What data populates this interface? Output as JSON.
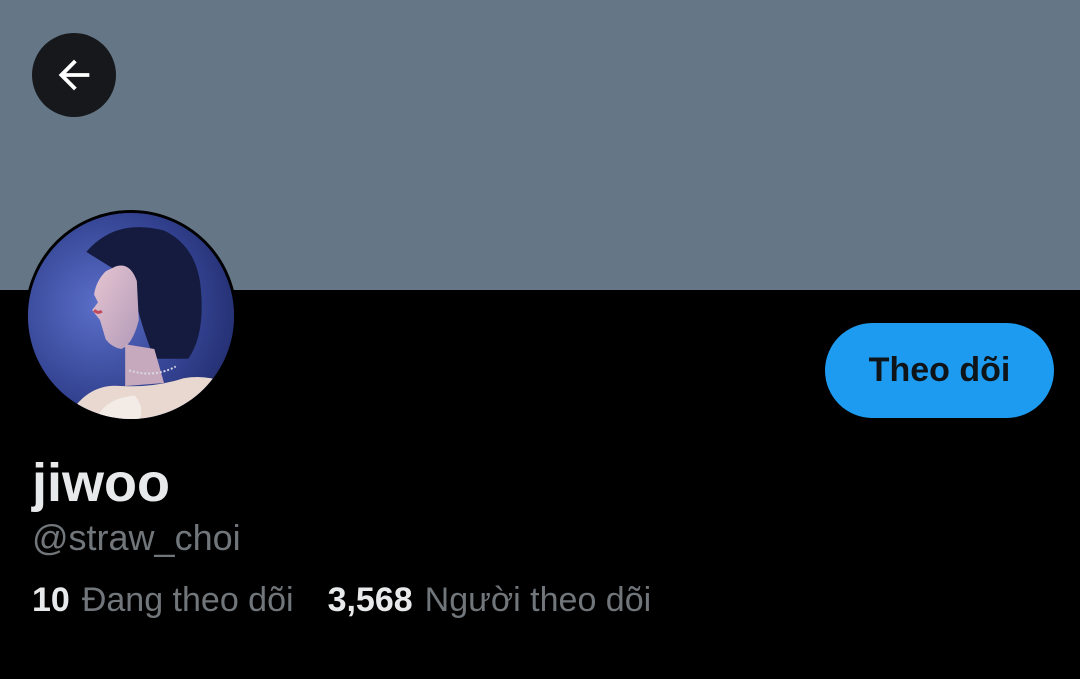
{
  "header": {
    "banner_color": "#657786",
    "back_icon": "arrow-left-icon"
  },
  "profile": {
    "display_name": "jiwoo",
    "handle": "@straw_choi",
    "follow_label": "Theo dõi",
    "follow_color": "#1d9bf0"
  },
  "stats": {
    "following_count": "10",
    "following_label": "Đang theo dõi",
    "followers_count": "3,568",
    "followers_label": "Người theo dõi"
  }
}
